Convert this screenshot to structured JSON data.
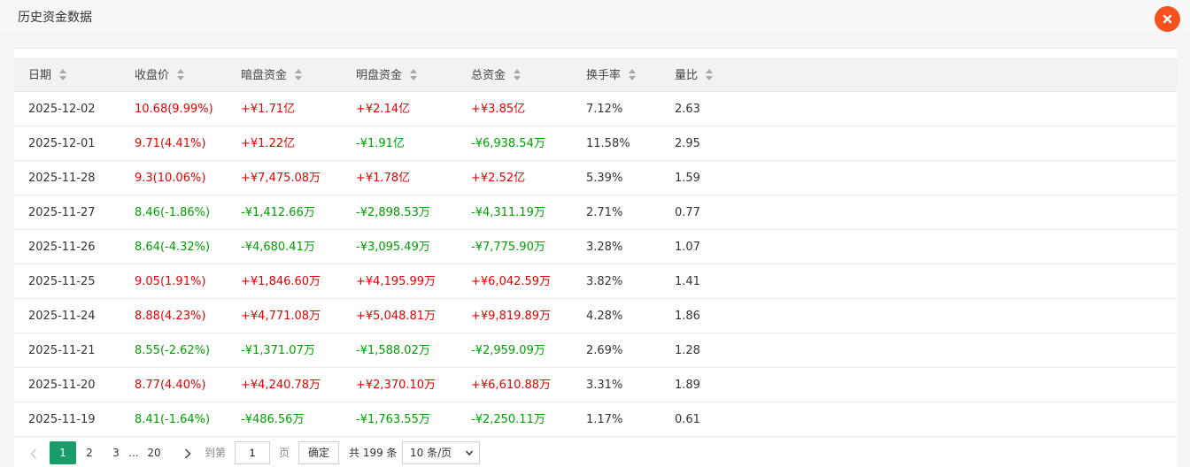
{
  "window": {
    "title": "历史资金数据"
  },
  "table": {
    "headers": [
      "日期",
      "收盘价",
      "暗盘资金",
      "明盘资金",
      "总资金",
      "换手率",
      "量比"
    ],
    "rows": [
      {
        "date": "2025-12-02",
        "close": "10.68(9.99%)",
        "close_dir": "red",
        "dark": "+¥1.71亿",
        "dark_dir": "red",
        "open": "+¥2.14亿",
        "open_dir": "red",
        "total": "+¥3.85亿",
        "total_dir": "red",
        "turnover": "7.12%",
        "vol_ratio": "2.63"
      },
      {
        "date": "2025-12-01",
        "close": "9.71(4.41%)",
        "close_dir": "red",
        "dark": "+¥1.22亿",
        "dark_dir": "red",
        "open": "-¥1.91亿",
        "open_dir": "green",
        "total": "-¥6,938.54万",
        "total_dir": "green",
        "turnover": "11.58%",
        "vol_ratio": "2.95"
      },
      {
        "date": "2025-11-28",
        "close": "9.3(10.06%)",
        "close_dir": "red",
        "dark": "+¥7,475.08万",
        "dark_dir": "red",
        "open": "+¥1.78亿",
        "open_dir": "red",
        "total": "+¥2.52亿",
        "total_dir": "red",
        "turnover": "5.39%",
        "vol_ratio": "1.59"
      },
      {
        "date": "2025-11-27",
        "close": "8.46(-1.86%)",
        "close_dir": "green",
        "dark": "-¥1,412.66万",
        "dark_dir": "green",
        "open": "-¥2,898.53万",
        "open_dir": "green",
        "total": "-¥4,311.19万",
        "total_dir": "green",
        "turnover": "2.71%",
        "vol_ratio": "0.77"
      },
      {
        "date": "2025-11-26",
        "close": "8.64(-4.32%)",
        "close_dir": "green",
        "dark": "-¥4,680.41万",
        "dark_dir": "green",
        "open": "-¥3,095.49万",
        "open_dir": "green",
        "total": "-¥7,775.90万",
        "total_dir": "green",
        "turnover": "3.28%",
        "vol_ratio": "1.07"
      },
      {
        "date": "2025-11-25",
        "close": "9.05(1.91%)",
        "close_dir": "red",
        "dark": "+¥1,846.60万",
        "dark_dir": "red",
        "open": "+¥4,195.99万",
        "open_dir": "red",
        "total": "+¥6,042.59万",
        "total_dir": "red",
        "turnover": "3.82%",
        "vol_ratio": "1.41"
      },
      {
        "date": "2025-11-24",
        "close": "8.88(4.23%)",
        "close_dir": "red",
        "dark": "+¥4,771.08万",
        "dark_dir": "red",
        "open": "+¥5,048.81万",
        "open_dir": "red",
        "total": "+¥9,819.89万",
        "total_dir": "red",
        "turnover": "4.28%",
        "vol_ratio": "1.86"
      },
      {
        "date": "2025-11-21",
        "close": "8.55(-2.62%)",
        "close_dir": "green",
        "dark": "-¥1,371.07万",
        "dark_dir": "green",
        "open": "-¥1,588.02万",
        "open_dir": "green",
        "total": "-¥2,959.09万",
        "total_dir": "green",
        "turnover": "2.69%",
        "vol_ratio": "1.28"
      },
      {
        "date": "2025-11-20",
        "close": "8.77(4.40%)",
        "close_dir": "red",
        "dark": "+¥4,240.78万",
        "dark_dir": "red",
        "open": "+¥2,370.10万",
        "open_dir": "red",
        "total": "+¥6,610.88万",
        "total_dir": "red",
        "turnover": "3.31%",
        "vol_ratio": "1.89"
      },
      {
        "date": "2025-11-19",
        "close": "8.41(-1.64%)",
        "close_dir": "green",
        "dark": "-¥486.56万",
        "dark_dir": "green",
        "open": "-¥1,763.55万",
        "open_dir": "green",
        "total": "-¥2,250.11万",
        "total_dir": "green",
        "turnover": "1.17%",
        "vol_ratio": "0.61"
      }
    ]
  },
  "pagination": {
    "pages": [
      "1",
      "2",
      "3"
    ],
    "ellipsis": "...",
    "last_page": "20",
    "current_page": "1",
    "goto_prefix": "到第",
    "goto_value": "1",
    "goto_suffix": "页",
    "confirm_label": "确定",
    "total_label": "共 199 条",
    "page_size": "10 条/页"
  },
  "colors": {
    "up": "#e60000",
    "down": "#00a000",
    "accent": "#1b9b6a",
    "close": "#f4511e"
  }
}
